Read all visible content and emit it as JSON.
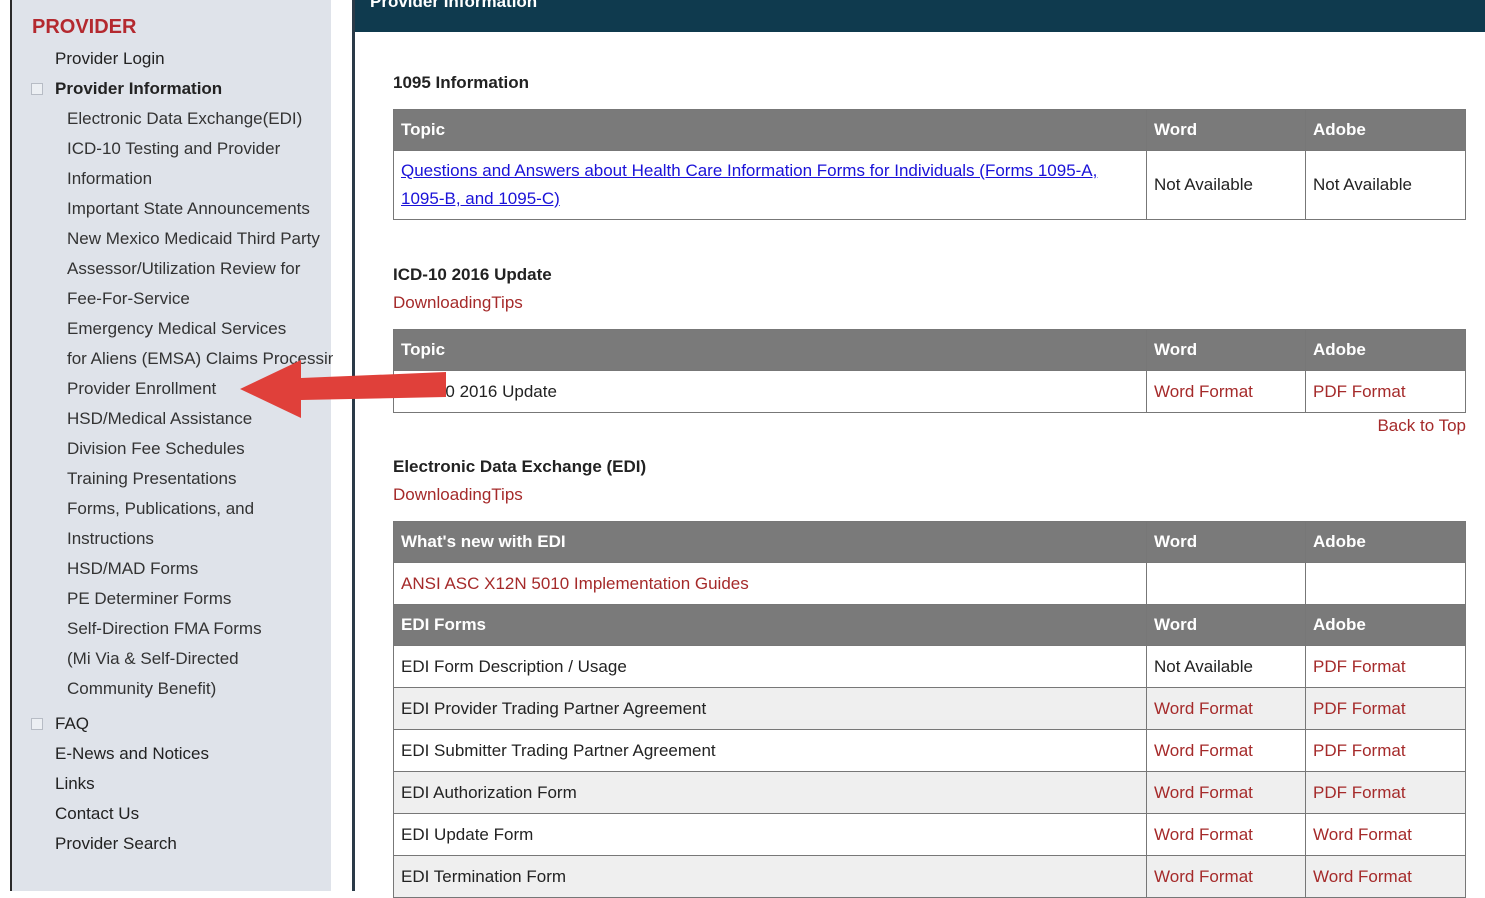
{
  "sidebar": {
    "title": "PROVIDER",
    "items": [
      {
        "label": "Provider Login"
      },
      {
        "label": "Provider Information"
      },
      {
        "label": "Electronic Data Exchange(EDI)"
      },
      {
        "label": "ICD-10 Testing and Provider"
      },
      {
        "label": "Information"
      },
      {
        "label": "Important State Announcements"
      },
      {
        "label": "New Mexico Medicaid Third Party"
      },
      {
        "label": "Assessor/Utilization Review for"
      },
      {
        "label": "Fee-For-Service"
      },
      {
        "label": "Emergency Medical Services"
      },
      {
        "label": "for Aliens (EMSA) Claims Processing"
      },
      {
        "label": "Provider Enrollment"
      },
      {
        "label": "HSD/Medical Assistance"
      },
      {
        "label": "Division Fee Schedules"
      },
      {
        "label": "Training Presentations"
      },
      {
        "label": "Forms, Publications, and"
      },
      {
        "label": "Instructions"
      },
      {
        "label": "HSD/MAD Forms"
      },
      {
        "label": "PE Determiner Forms"
      },
      {
        "label": "Self-Direction FMA Forms"
      },
      {
        "label": "(Mi Via & Self-Directed"
      },
      {
        "label": "Community Benefit)"
      },
      {
        "label": "FAQ"
      },
      {
        "label": "E-News and Notices"
      },
      {
        "label": "Links"
      },
      {
        "label": "Contact Us"
      },
      {
        "label": "Provider Search"
      }
    ]
  },
  "header": {
    "title": "Provider Information"
  },
  "sections": {
    "info1095": {
      "title": "1095 Information",
      "headers": [
        "Topic",
        "Word",
        "Adobe"
      ],
      "rows": [
        {
          "topic": "Questions and Answers about Health Care Information Forms for Individuals (Forms 1095-A, 1095-B, and 1095-C)",
          "word": "Not Available",
          "adobe": "Not Available"
        }
      ]
    },
    "icd10": {
      "title": "ICD-10 2016 Update",
      "tips": "DownloadingTips",
      "headers": [
        "Topic",
        "Word",
        "Adobe"
      ],
      "rows": [
        {
          "topic": "ICD-10 2016 Update",
          "word": "Word Format",
          "adobe": "PDF Format"
        }
      ]
    },
    "back_to_top": "Back to Top",
    "edi": {
      "title": "Electronic Data Exchange (EDI)",
      "tips": "DownloadingTips",
      "headers": [
        "What's new with EDI",
        "Word",
        "Adobe"
      ],
      "new_row": {
        "topic": "ANSI ASC X12N 5010 Implementation Guides",
        "word": "",
        "adobe": ""
      },
      "forms_headers": [
        "EDI Forms",
        "Word",
        "Adobe"
      ],
      "forms": [
        {
          "topic": "EDI Form Description / Usage",
          "word": "Not Available",
          "adobe": "PDF Format"
        },
        {
          "topic": "EDI Provider Trading Partner Agreement",
          "word": "Word Format",
          "adobe": "PDF Format"
        },
        {
          "topic": "EDI Submitter Trading Partner Agreement",
          "word": "Word Format",
          "adobe": "PDF Format"
        },
        {
          "topic": "EDI Authorization Form",
          "word": "Word Format",
          "adobe": "PDF Format"
        },
        {
          "topic": "EDI Update Form",
          "word": "Word Format",
          "adobe": "Word Format"
        },
        {
          "topic": "EDI Termination Form",
          "word": "Word Format",
          "adobe": "Word Format"
        }
      ]
    }
  },
  "annotation": {
    "arrow_color": "#e0403a"
  }
}
